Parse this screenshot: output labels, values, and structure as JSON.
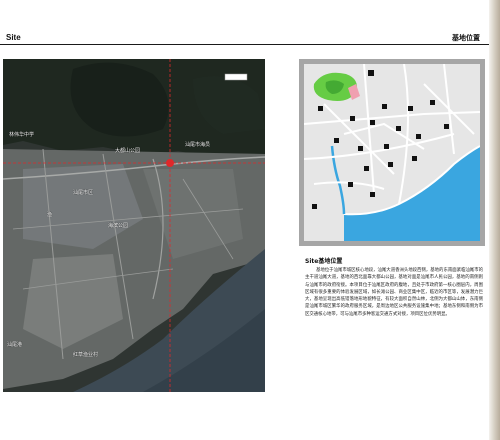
{
  "header": {
    "left_label": "Site",
    "right_label": "基地位置"
  },
  "aerial_map": {
    "labels": [
      "林伟华中学",
      "大都山公园",
      "汕尾市海员",
      "汕尾市区",
      "渔",
      "海滨公园",
      "汕尾港",
      "红草渔业村"
    ]
  },
  "section": {
    "title": "Site基地位置",
    "body": "基地位于汕尾市城区核心地段，汕尾大道香洲头地段西侧，基地的东南面紧临汕尾市的主干道汕尾大道，基地的西北面靠大都山公园，基地对面是汕尾市人民公园，基地的南侧则与汕尾市的政府衔接。本项目位于汕尾区政府的腹地，且处于市政府第一核心圈层内，周围区域有很多重要的体验发展区域，如长滩公园、商业区集中区，临近的市区等，发展潜力巨大，基地呈现出高低错落地形地貌特征，有较大面积自然山林，北侧为大都山山体，东南侧是汕尾市城区繁华的政府服务区域，是周边地区公共服务设施集中地；基地东侧和南侧为市区交通核心地带，可与汕尾市多种客运交通方式对接，项目区位优势明显。"
  },
  "colors": {
    "crosshair": "#e0282a",
    "sea": "#3aa6e0",
    "park": "#66cc44",
    "site": "#f0a0b0"
  }
}
